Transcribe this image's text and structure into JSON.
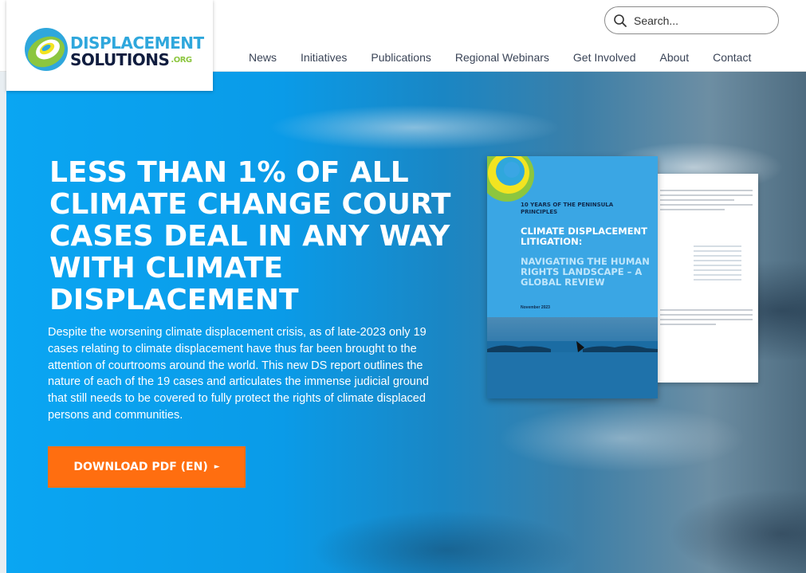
{
  "brand": {
    "name_line1": "DISPLACEMENT",
    "name_line2": "SOLUTIONS",
    "suffix": ".ORG"
  },
  "search": {
    "placeholder": "Search..."
  },
  "nav": {
    "items": [
      "News",
      "Initiatives",
      "Publications",
      "Regional Webinars",
      "Get Involved",
      "About",
      "Contact"
    ]
  },
  "hero": {
    "headline": "LESS THAN 1% OF ALL CLIMATE CHANGE COURT CASES DEAL IN ANY WAY WITH CLIMATE DISPLACEMENT",
    "body": "Despite the worsening climate displacement crisis, as of late-2023 only 19 cases relating to climate displacement have thus far been brought to the attention of courtrooms around the world. This new DS report outlines the nature of each of the 19 cases and articulates the immense judicial ground that still needs to be covered to fully protect the rights of climate displaced persons and communities.",
    "cta_label": "DOWNLOAD PDF (EN)",
    "cta_arrow": "►"
  },
  "report_cover": {
    "series": "10 YEARS OF THE PENINSULA PRINCIPLES",
    "title": "CLIMATE DISPLACEMENT LITIGATION:",
    "subtitle": "NAVIGATING THE HUMAN RIGHTS LANDSCAPE – A GLOBAL REVIEW",
    "date": "November 2023"
  },
  "colors": {
    "brand_blue": "#2fa7dc",
    "brand_navy": "#101d3f",
    "brand_green": "#8cc63f",
    "cta_orange": "#ff6e10",
    "hero_blue": "#0aa6f3"
  }
}
